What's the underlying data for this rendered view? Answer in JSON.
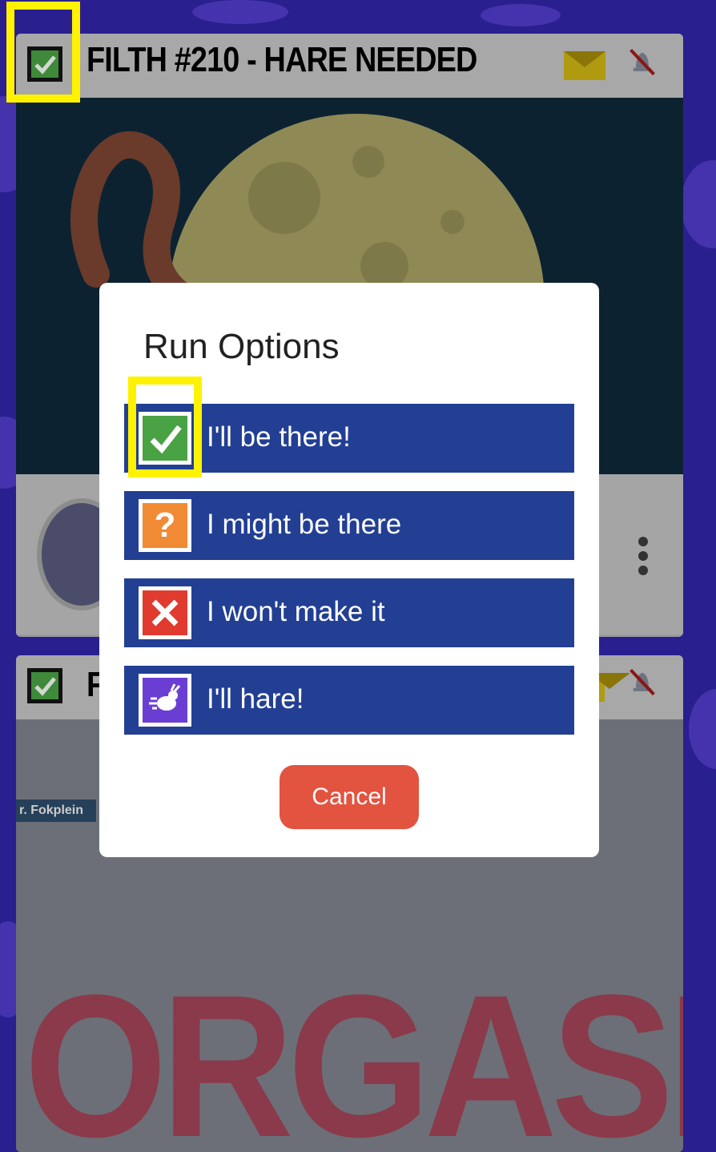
{
  "card1": {
    "title": "FILTH #210 - HARE NEEDED",
    "icons": [
      "checkbox-checked-icon",
      "mail-icon",
      "bell-muted-icon",
      "kebab-menu-icon"
    ]
  },
  "card2": {
    "title_visible": "F",
    "icons": [
      "checkbox-checked-icon",
      "bell-muted-icon"
    ],
    "street_sign": "r. Fokplein",
    "graffiti": "ORGASM"
  },
  "dialog": {
    "title": "Run Options",
    "options": [
      {
        "label": "I'll be there!",
        "icon": "checkmark-icon",
        "color": "#49a244"
      },
      {
        "label": "I might be there",
        "icon": "question-icon",
        "color": "#f08a34"
      },
      {
        "label": "I won't make it",
        "icon": "x-icon",
        "color": "#e13a2f"
      },
      {
        "label": "I'll hare!",
        "icon": "rabbit-icon",
        "color": "#6a3ed3"
      }
    ],
    "cancel_label": "Cancel"
  },
  "colors": {
    "background": "#2a1f8f",
    "option_bg": "#223f94",
    "cancel_bg": "#e25340",
    "highlight": "#fff200"
  }
}
